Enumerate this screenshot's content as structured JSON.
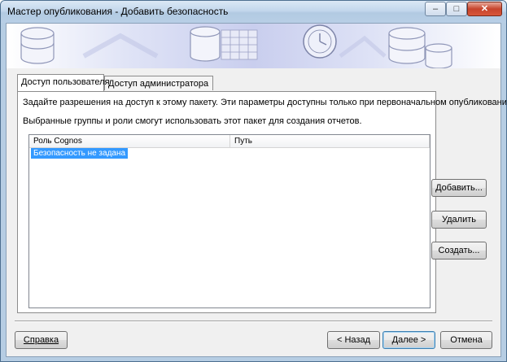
{
  "window": {
    "title": "Мастер опубликования - Добавить безопасность",
    "controls": {
      "minimize": "–",
      "maximize": "□",
      "close": "✕"
    }
  },
  "tabs": [
    {
      "label": "Доступ пользователя",
      "active": true
    },
    {
      "label": "Доступ администратора",
      "active": false
    }
  ],
  "panel": {
    "description": "Задайте разрешения на доступ к этому пакету.  Эти параметры доступны только при первоначальном опубликовании.",
    "note": "Выбранные группы и роли смогут использовать этот пакет для создания отчетов.",
    "columns": [
      "Роль Cognos",
      "Путь"
    ],
    "rows": [
      {
        "role": "Безопасность не задана",
        "path": "",
        "selected": true
      }
    ]
  },
  "side_buttons": {
    "add": "Добавить...",
    "remove": "Удалить",
    "create": "Создать..."
  },
  "footer": {
    "help": "Справка",
    "back": "< Назад",
    "next": "Далее >",
    "cancel": "Отмена"
  },
  "colors": {
    "titlebar": "#c3d7ec",
    "dialog": "#f0f0f0",
    "selection": "#3399ff",
    "banner": "#c9ceee"
  }
}
